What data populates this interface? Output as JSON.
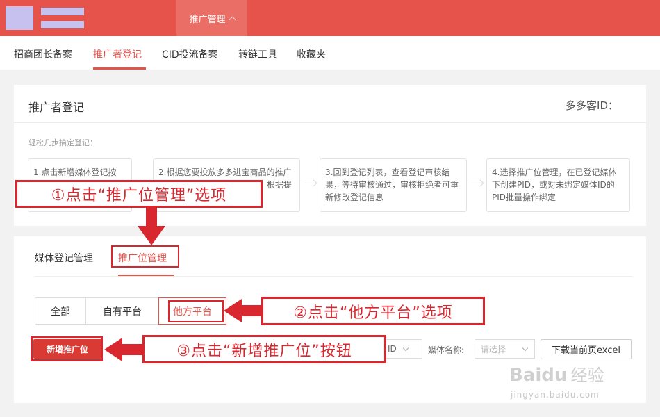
{
  "header": {
    "active_tab": "推广管理"
  },
  "subnav": {
    "items": [
      "招商团长备案",
      "推广者登记",
      "CID投流备案",
      "转链工具",
      "收藏夹"
    ],
    "active_index": 1
  },
  "register_card": {
    "title": "推广者登记",
    "pid_label": "多多客ID：",
    "hint": "轻松几步搞定登记：",
    "steps": [
      "1.点击新增媒体登记按",
      "2.根据您要投放多多进宝商品的推广媒体类型，选择对应的管理，根据提示填写信息并提交",
      "3.回到登记列表，查看登记审核结果，等待审核通过，审核拒绝者可重新修改登记信息",
      "4.选择推广位管理，在已登记媒体下创建PID，或对未绑定媒体ID的PID批量操作绑定"
    ]
  },
  "manage_card": {
    "tabs": [
      "媒体登记管理",
      "推广位管理"
    ],
    "active_tab_index": 1,
    "segments": [
      "全部",
      "自有平台",
      "他方平台"
    ],
    "active_segment_index": 2,
    "add_button": "新增推广位",
    "id_filter_fragment": "ID",
    "media_name_label": "媒体名称:",
    "media_name_placeholder": "请选择",
    "download_button": "下载当前页excel"
  },
  "annotations": {
    "step1": "①点击“推广位管理”选项",
    "step2": "②点击“他方平台”选项",
    "step3": "③点击“新增推广位”按钮",
    "color": "#d9272f"
  },
  "watermark": {
    "logo": "Baidu",
    "cn": "经验",
    "url": "jingyan.baidu.com"
  },
  "colors": {
    "brand": "#e5534b",
    "active_tab_bg": "#ea6e66",
    "button": "#d93a33"
  }
}
